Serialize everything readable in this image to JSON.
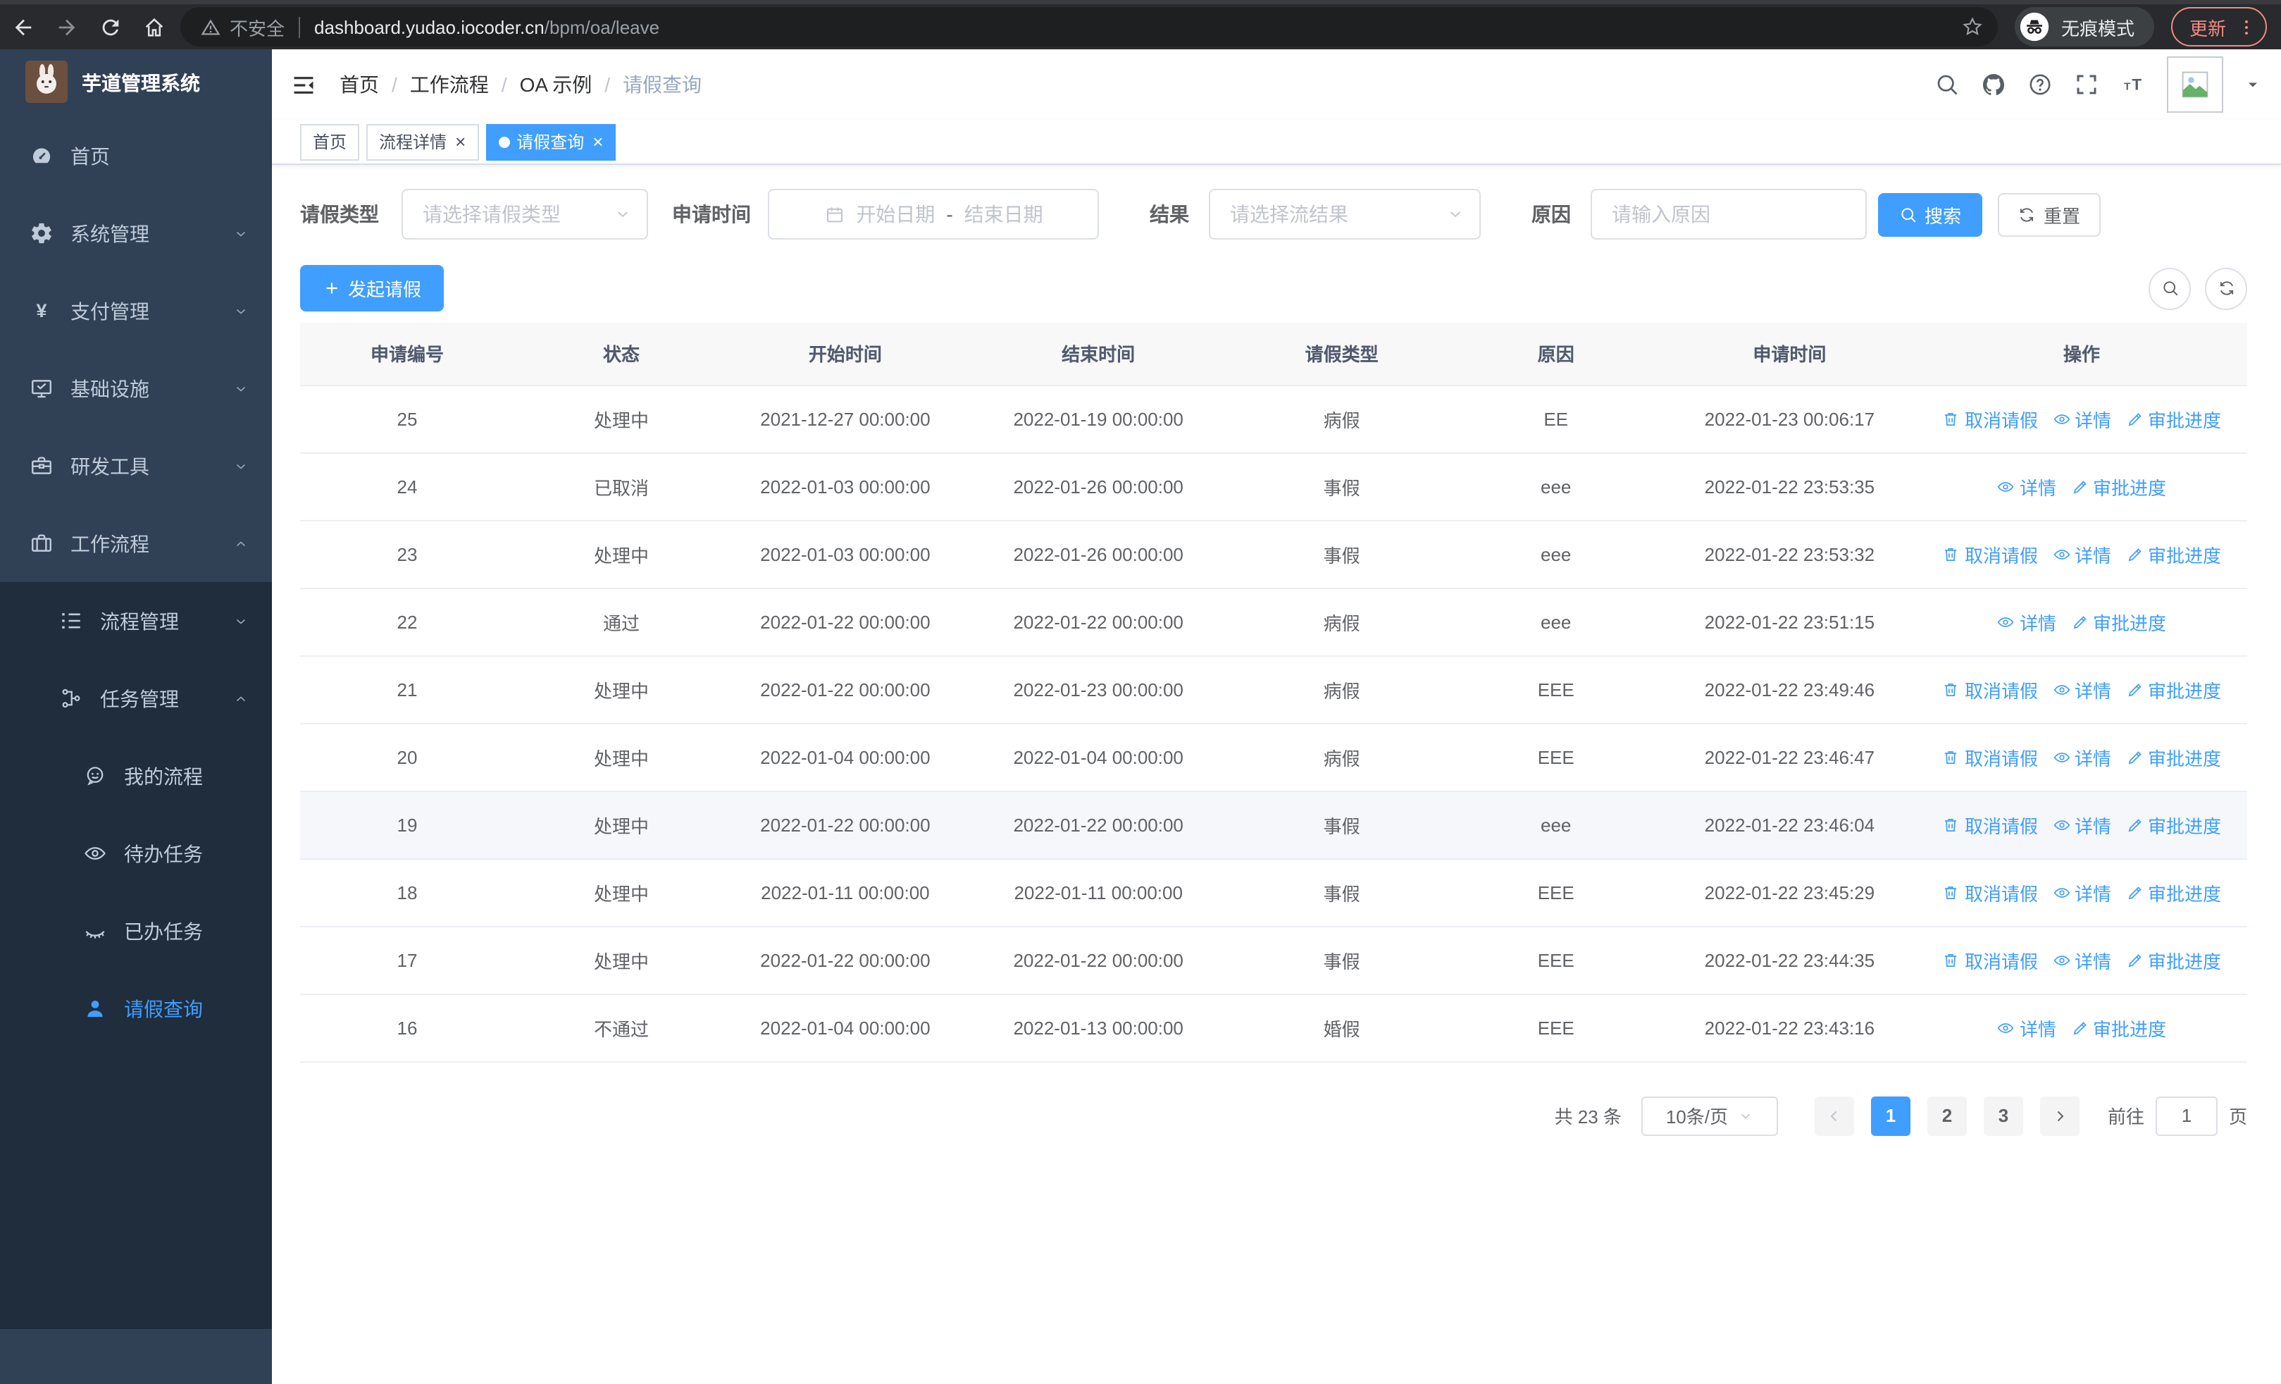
{
  "browser": {
    "security_label": "不安全",
    "url_host": "dashboard.yudao.iocoder.cn",
    "url_path": "/bpm/oa/leave",
    "incognito_label": "无痕模式",
    "update_label": "更新"
  },
  "sidebar": {
    "title": "芋道管理系统",
    "menu_top": [
      {
        "name": "home",
        "label": "首页",
        "icon": "dashboard-icon",
        "level": 1
      },
      {
        "name": "system-management",
        "label": "系统管理",
        "icon": "gear-icon",
        "level": 1,
        "arrow": "down"
      },
      {
        "name": "payment-management",
        "label": "支付管理",
        "icon": "yen-icon",
        "level": 1,
        "arrow": "down"
      },
      {
        "name": "infrastructure",
        "label": "基础设施",
        "icon": "monitor-icon",
        "level": 1,
        "arrow": "down"
      },
      {
        "name": "dev-tools",
        "label": "研发工具",
        "icon": "toolbox-icon",
        "level": 1,
        "arrow": "down"
      },
      {
        "name": "workflow",
        "label": "工作流程",
        "icon": "briefcase-icon",
        "level": 1,
        "arrow": "up"
      }
    ],
    "menu_sub": [
      {
        "name": "process-management",
        "label": "流程管理",
        "icon": "list-icon",
        "level": 2,
        "arrow": "down"
      },
      {
        "name": "task-management",
        "label": "任务管理",
        "icon": "tree-icon",
        "level": 2,
        "arrow": "up"
      },
      {
        "name": "my-process",
        "label": "我的流程",
        "icon": "chat-icon",
        "level": 3
      },
      {
        "name": "todo-tasks",
        "label": "待办任务",
        "icon": "eye-open-icon",
        "level": 3
      },
      {
        "name": "done-tasks",
        "label": "已办任务",
        "icon": "eye-closed-icon",
        "level": 3
      },
      {
        "name": "leave-query",
        "label": "请假查询",
        "icon": "user-icon",
        "level": 3,
        "active": true
      }
    ]
  },
  "breadcrumb": [
    "首页",
    "工作流程",
    "OA 示例",
    "请假查询"
  ],
  "tabs": [
    {
      "name": "tab-home",
      "label": "首页",
      "closable": false,
      "active": false
    },
    {
      "name": "tab-process-detail",
      "label": "流程详情",
      "closable": true,
      "active": false
    },
    {
      "name": "tab-leave-query",
      "label": "请假查询",
      "closable": true,
      "active": true
    }
  ],
  "filters": {
    "type_label": "请假类型",
    "type_placeholder": "请选择请假类型",
    "time_label": "申请时间",
    "start_placeholder": "开始日期",
    "separator": "-",
    "end_placeholder": "结束日期",
    "result_label": "结果",
    "result_placeholder": "请选择流结果",
    "reason_label": "原因",
    "reason_placeholder": "请输入原因",
    "search_label": "搜索",
    "reset_label": "重置"
  },
  "toolbar": {
    "create_label": "发起请假"
  },
  "table": {
    "columns": [
      "申请编号",
      "状态",
      "开始时间",
      "结束时间",
      "请假类型",
      "原因",
      "申请时间",
      "操作"
    ],
    "action_labels": {
      "cancel": "取消请假",
      "detail": "详情",
      "progress": "审批进度"
    },
    "rows": [
      {
        "id": "25",
        "status": "处理中",
        "start": "2021-12-27 00:00:00",
        "end": "2022-01-19 00:00:00",
        "type": "病假",
        "reason": "EE",
        "applied": "2022-01-23 00:06:17",
        "actions": [
          "cancel",
          "detail",
          "progress"
        ],
        "highlight": false
      },
      {
        "id": "24",
        "status": "已取消",
        "start": "2022-01-03 00:00:00",
        "end": "2022-01-26 00:00:00",
        "type": "事假",
        "reason": "eee",
        "applied": "2022-01-22 23:53:35",
        "actions": [
          "detail",
          "progress"
        ],
        "highlight": false
      },
      {
        "id": "23",
        "status": "处理中",
        "start": "2022-01-03 00:00:00",
        "end": "2022-01-26 00:00:00",
        "type": "事假",
        "reason": "eee",
        "applied": "2022-01-22 23:53:32",
        "actions": [
          "cancel",
          "detail",
          "progress"
        ],
        "highlight": false
      },
      {
        "id": "22",
        "status": "通过",
        "start": "2022-01-22 00:00:00",
        "end": "2022-01-22 00:00:00",
        "type": "病假",
        "reason": "eee",
        "applied": "2022-01-22 23:51:15",
        "actions": [
          "detail",
          "progress"
        ],
        "highlight": false
      },
      {
        "id": "21",
        "status": "处理中",
        "start": "2022-01-22 00:00:00",
        "end": "2022-01-23 00:00:00",
        "type": "病假",
        "reason": "EEE",
        "applied": "2022-01-22 23:49:46",
        "actions": [
          "cancel",
          "detail",
          "progress"
        ],
        "highlight": false
      },
      {
        "id": "20",
        "status": "处理中",
        "start": "2022-01-04 00:00:00",
        "end": "2022-01-04 00:00:00",
        "type": "病假",
        "reason": "EEE",
        "applied": "2022-01-22 23:46:47",
        "actions": [
          "cancel",
          "detail",
          "progress"
        ],
        "highlight": false
      },
      {
        "id": "19",
        "status": "处理中",
        "start": "2022-01-22 00:00:00",
        "end": "2022-01-22 00:00:00",
        "type": "事假",
        "reason": "eee",
        "applied": "2022-01-22 23:46:04",
        "actions": [
          "cancel",
          "detail",
          "progress"
        ],
        "highlight": true
      },
      {
        "id": "18",
        "status": "处理中",
        "start": "2022-01-11 00:00:00",
        "end": "2022-01-11 00:00:00",
        "type": "事假",
        "reason": "EEE",
        "applied": "2022-01-22 23:45:29",
        "actions": [
          "cancel",
          "detail",
          "progress"
        ],
        "highlight": false
      },
      {
        "id": "17",
        "status": "处理中",
        "start": "2022-01-22 00:00:00",
        "end": "2022-01-22 00:00:00",
        "type": "事假",
        "reason": "EEE",
        "applied": "2022-01-22 23:44:35",
        "actions": [
          "cancel",
          "detail",
          "progress"
        ],
        "highlight": false
      },
      {
        "id": "16",
        "status": "不通过",
        "start": "2022-01-04 00:00:00",
        "end": "2022-01-13 00:00:00",
        "type": "婚假",
        "reason": "EEE",
        "applied": "2022-01-22 23:43:16",
        "actions": [
          "detail",
          "progress"
        ],
        "highlight": false
      }
    ]
  },
  "pagination": {
    "total_label": "共 23 条",
    "page_size": "10条/页",
    "pages": [
      "1",
      "2",
      "3"
    ],
    "active_page": "1",
    "goto_label": "前往",
    "goto_value": "1",
    "page_label": "页"
  },
  "colors": {
    "accent": "#409EFF",
    "sidebar_bg": "#304156",
    "submenu_bg": "#1f2d3d",
    "update_red": "#f28b82"
  }
}
